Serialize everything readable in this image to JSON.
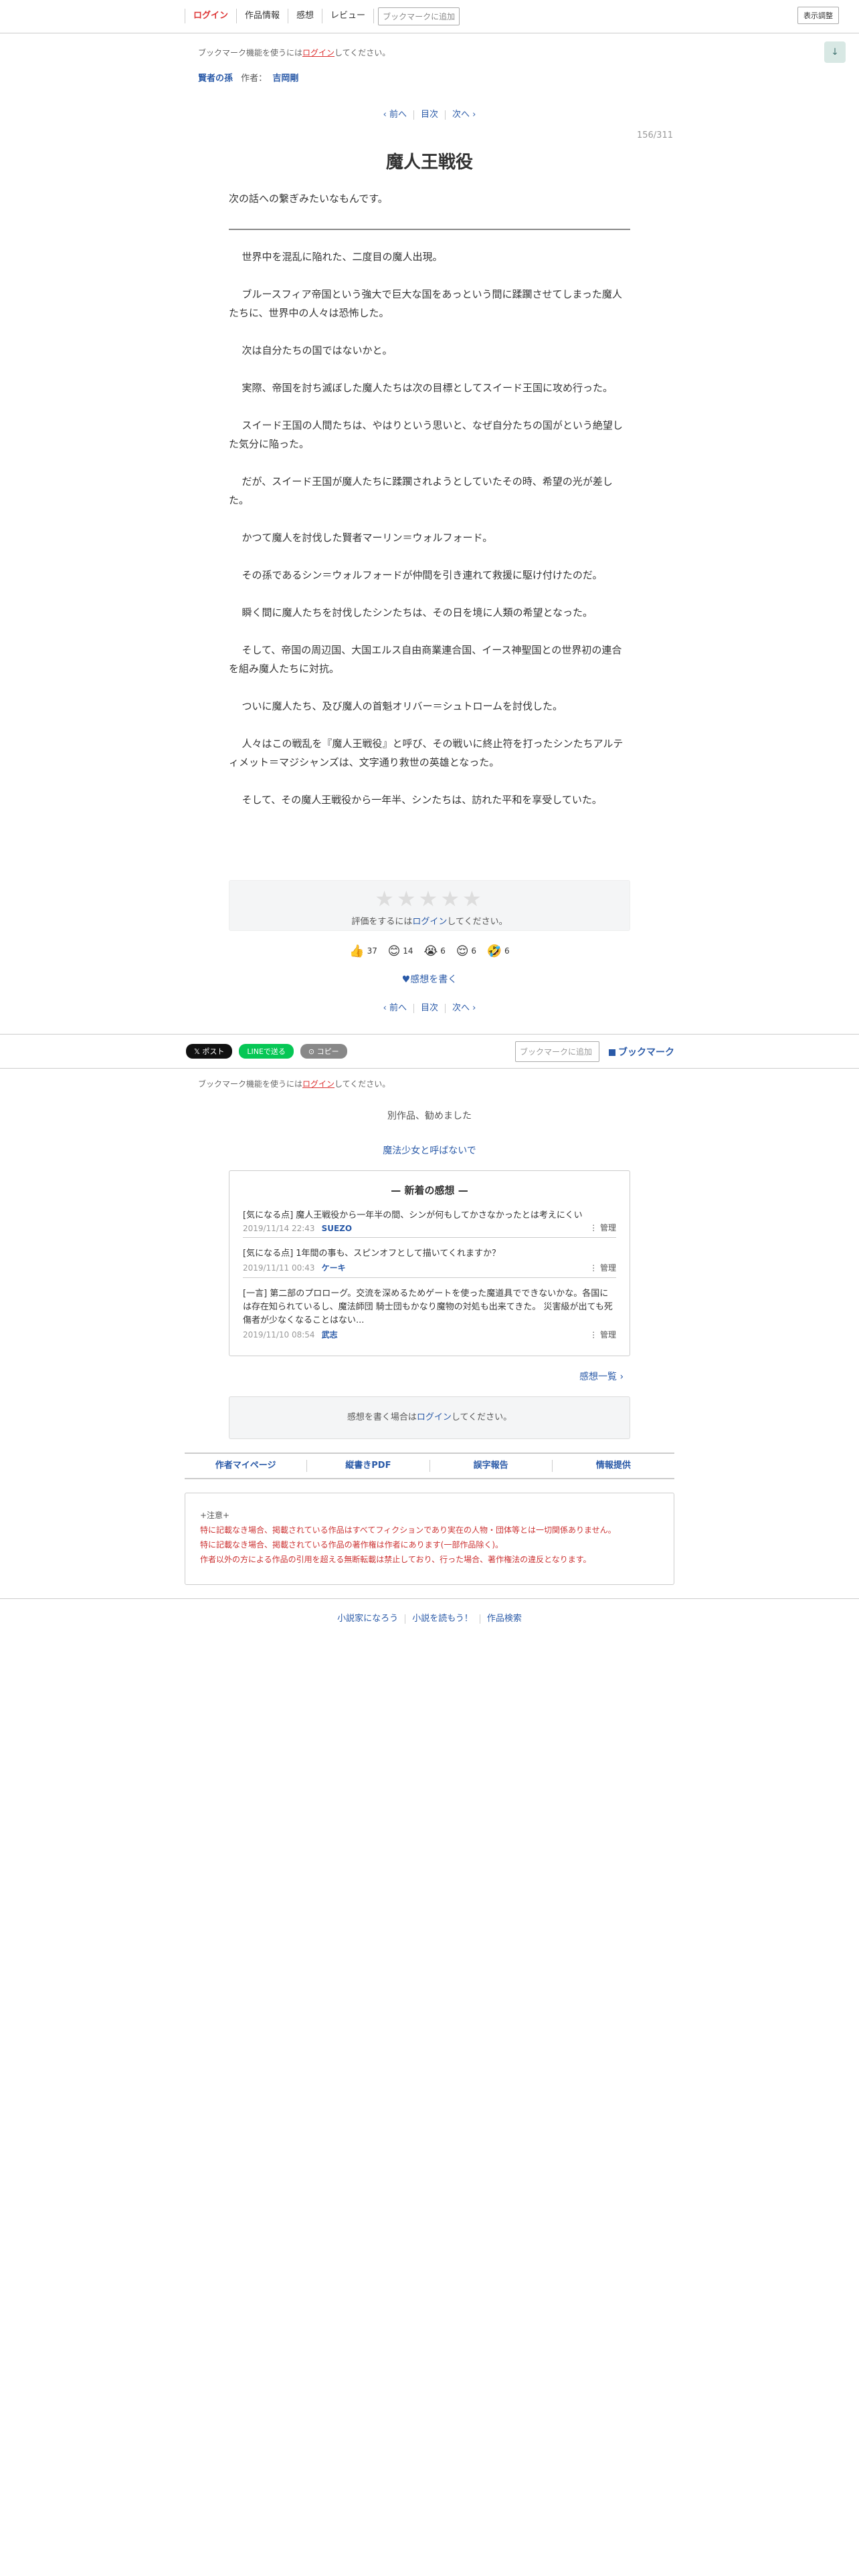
{
  "header": {
    "login": "ログイン",
    "nav": [
      "作品情報",
      "感想",
      "レビュー"
    ],
    "bookmark_add": "ブックマークに追加",
    "display_settings": "表示調整",
    "scroll_down": "↓"
  },
  "bookmark_notice": {
    "prefix": "ブックマーク機能を使うには",
    "login": "ログイン",
    "suffix": "してください。"
  },
  "series": {
    "title": "賢者の孫",
    "author_label": "作者：",
    "author": "吉岡剛"
  },
  "pager": {
    "prev": "‹ 前へ",
    "toc": "目次",
    "next": "次へ ›"
  },
  "progress": "156/311",
  "chapter": {
    "title": "魔人王戦役",
    "preface": "次の話への繋ぎみたいなもんです。",
    "paragraphs": [
      "世界中を混乱に陥れた、二度目の魔人出現。",
      "ブルースフィア帝国という強大で巨大な国をあっという間に蹂躙させてしまった魔人たちに、世界中の人々は恐怖した。",
      "次は自分たちの国ではないかと。",
      "実際、帝国を討ち滅ぼした魔人たちは次の目標としてスイード王国に攻め行った。",
      "スイード王国の人間たちは、やはりという思いと、なぜ自分たちの国がという絶望した気分に陥った。",
      "だが、スイード王国が魔人たちに蹂躙されようとしていたその時、希望の光が差した。",
      "かつて魔人を討伐した賢者マーリン＝ウォルフォード。",
      "その孫であるシン＝ウォルフォードが仲間を引き連れて救援に駆け付けたのだ。",
      "瞬く間に魔人たちを討伐したシンたちは、その日を境に人類の希望となった。",
      "そして、帝国の周辺国、大国エルス自由商業連合国、イース神聖国との世界初の連合を組み魔人たちに対抗。",
      "ついに魔人たち、及び魔人の首魁オリバー＝シュトロームを討伐した。",
      "人々はこの戦乱を『魔人王戦役』と呼び、その戦いに終止符を打ったシンたちアルティメット＝マジシャンズは、文字通り救世の英雄となった。",
      "そして、その魔人王戦役から一年半、シンたちは、訪れた平和を享受していた。"
    ]
  },
  "rating": {
    "stars": [
      "★",
      "★",
      "★",
      "★",
      "★"
    ],
    "prefix": "評価をするには",
    "login": "ログイン",
    "suffix": "してください。"
  },
  "reactions": [
    {
      "emoji": "👍",
      "count": "37"
    },
    {
      "emoji": "😊",
      "count": "14"
    },
    {
      "emoji": "😭",
      "count": "6"
    },
    {
      "emoji": "😌",
      "count": "6"
    },
    {
      "emoji": "🤣",
      "count": "6"
    }
  ],
  "write_impression": "♥感想を書く",
  "share": {
    "x": "𝕏 ポスト",
    "line": "LINEで送る",
    "copy": "⊙ コピー",
    "bookmark_add": "ブックマークに追加",
    "bookmark": "ブックマーク"
  },
  "recommend": {
    "label": "別作品、勧めました",
    "link": "魔法少女と呼ばないで"
  },
  "impressions": {
    "title": "— 新着の感想 —",
    "manage": "⋮ 管理",
    "items": [
      {
        "text": "[気になる点] 魔人王戦役から一年半の間、シンが何もしてかさなかったとは考えにくい",
        "date": "2019/11/14 22:43",
        "user": "SUEZO"
      },
      {
        "text": "[気になる点] 1年間の事も、スピンオフとして描いてくれますか？",
        "date": "2019/11/11 00:43",
        "user": "ケーキ"
      },
      {
        "text": "[一言] 第二部のプロローグ。交流を深めるためゲートを使った魔道具でできないかな。各国には存在知られているし、魔法師団 騎士団もかなり魔物の対処も出来てきた。 災害級が出ても死傷者が少なくなることはない...",
        "date": "2019/11/10 08:54",
        "user": "武志"
      }
    ],
    "list_link": "感想一覧 ›"
  },
  "write_box": {
    "prefix": "感想を書く場合は",
    "login": "ログイン",
    "suffix": "してください。"
  },
  "footer_nav": [
    "作者マイページ",
    "縦書きPDF",
    "誤字報告",
    "情報提供"
  ],
  "caution": {
    "head": "+注意+",
    "lines": [
      "特に記載なき場合、掲載されている作品はすべてフィクションであり実在の人物・団体等とは一切関係ありません。",
      "特に記載なき場合、掲載されている作品の著作権は作者にあります(一部作品除く)。",
      "作者以外の方による作品の引用を超える無断転載は禁止しており、行った場合、著作権法の違反となります。"
    ]
  },
  "site_footer": [
    "小説家になろう",
    "小説を読もう！",
    "作品検索"
  ]
}
